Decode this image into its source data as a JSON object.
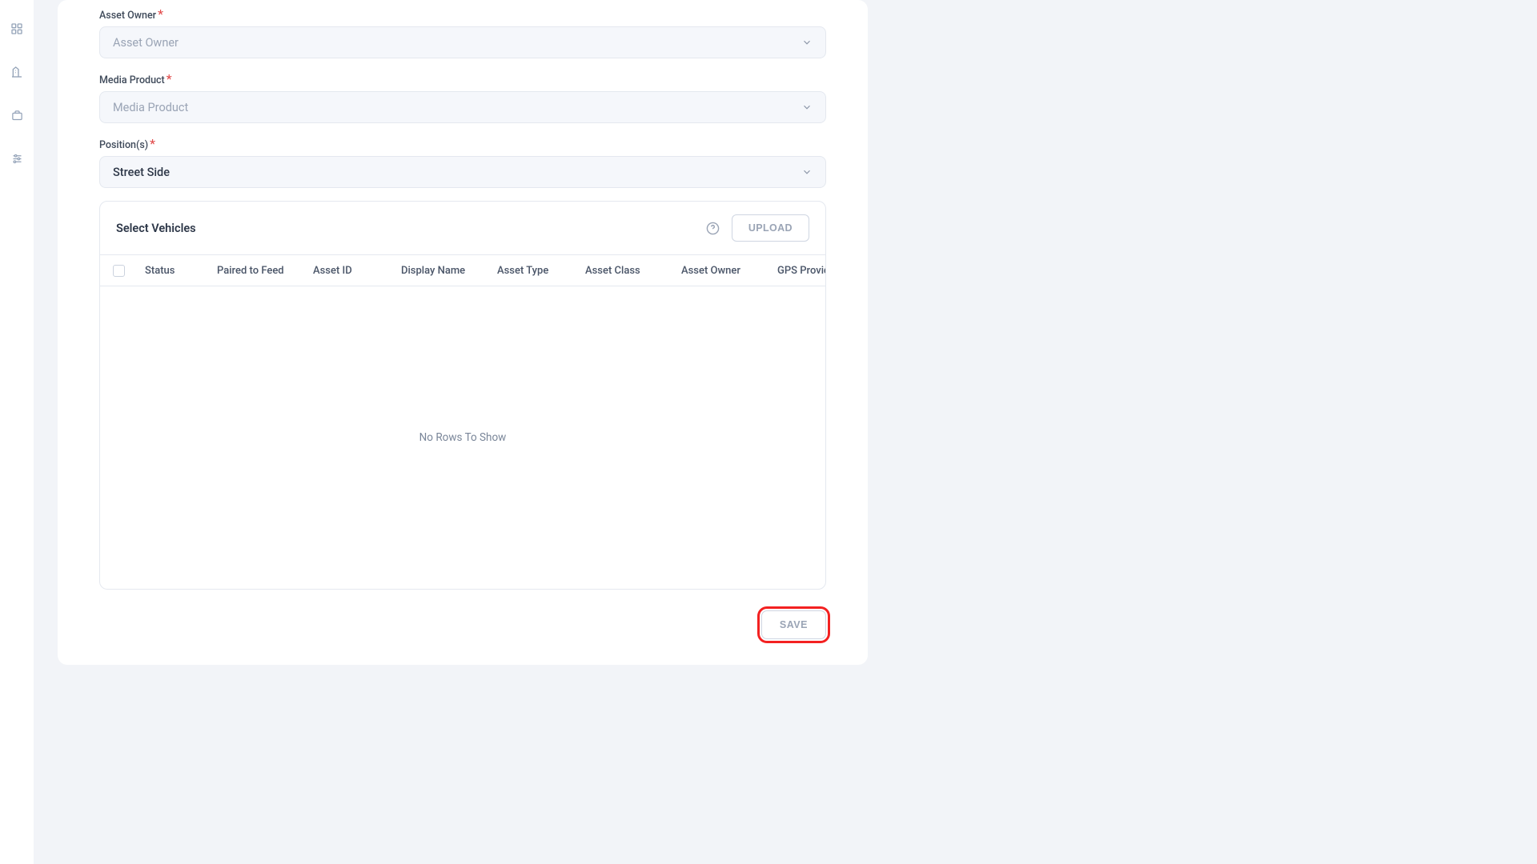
{
  "sidebar": {
    "items": [
      {
        "name": "dashboard-icon"
      },
      {
        "name": "buildings-icon"
      },
      {
        "name": "briefcase-icon"
      },
      {
        "name": "sliders-icon"
      }
    ]
  },
  "form": {
    "asset_owner": {
      "label": "Asset Owner",
      "placeholder": "Asset Owner",
      "required": true
    },
    "media_product": {
      "label": "Media Product",
      "placeholder": "Media Product",
      "required": true
    },
    "positions": {
      "label": "Position(s)",
      "value": "Street Side",
      "required": true
    }
  },
  "vehicles": {
    "title": "Select Vehicles",
    "upload_label": "UPLOAD",
    "columns": [
      "Status",
      "Paired to Feed",
      "Asset ID",
      "Display Name",
      "Asset Type",
      "Asset Class",
      "Asset Owner",
      "GPS Provider"
    ],
    "rows": [],
    "empty_text": "No Rows To Show"
  },
  "actions": {
    "save_label": "SAVE"
  }
}
